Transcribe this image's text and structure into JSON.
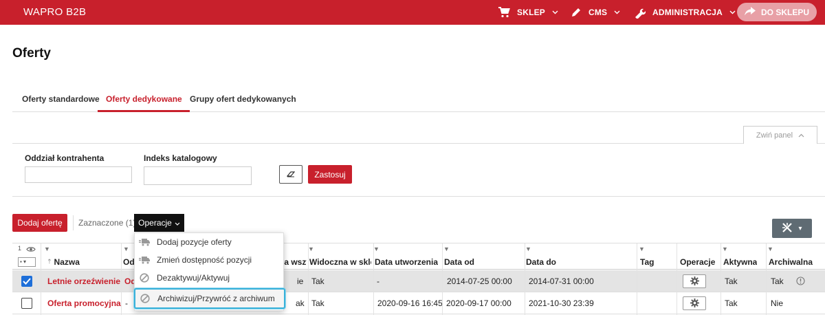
{
  "topbar": {
    "brand": "WAPRO B2B",
    "nav": [
      {
        "label": "SKLEP",
        "icon": "cart-icon"
      },
      {
        "label": "CMS",
        "icon": "pencil-icon"
      },
      {
        "label": "ADMINISTRACJA",
        "icon": "wrench-icon"
      }
    ],
    "shop_button": "DO SKLEPU",
    "brand_color": "#c8202c"
  },
  "page_title": "Oferty",
  "tabs": [
    {
      "label": "Oferty standardowe",
      "active": false
    },
    {
      "label": "Oferty dedykowane",
      "active": true
    },
    {
      "label": "Grupy ofert dedykowanych",
      "active": false
    }
  ],
  "panel": {
    "collapse_label": "Zwiń panel"
  },
  "filters": {
    "fields": [
      {
        "label": "Oddział kontrahenta",
        "value": ""
      },
      {
        "label": "Indeks katalogowy",
        "value": ""
      }
    ],
    "apply_label": "Zastosuj"
  },
  "toolbar": {
    "add_label": "Dodaj ofertę",
    "selected_label": "Zaznaczone (1)",
    "operations_label": "Operacje"
  },
  "dropdown": {
    "items": [
      {
        "label": "Dodaj pozycje oferty",
        "icon": "truck-add-icon"
      },
      {
        "label": "Zmień dostępność pozycji",
        "icon": "truck-edit-icon"
      },
      {
        "label": "Dezaktywuj/Aktywuj",
        "icon": "block-icon"
      },
      {
        "label": "Archiwizuj/Przywróć z archiwum",
        "icon": "block-icon",
        "highlighted": true
      }
    ]
  },
  "grid": {
    "pin_count": "1",
    "columns": [
      "Nazwa",
      "Od",
      "la wszy",
      "Widoczna w sklepi",
      "Data utworzenia",
      "Data od",
      "Data do",
      "Tag",
      "Operacje",
      "Aktywna",
      "Archiwalna"
    ],
    "rows": [
      {
        "selected": true,
        "name": "Letnie orzeźwienie",
        "od": "Od",
        "wszy": "ie",
        "visible": "Tak",
        "created": "-",
        "from": "2014-07-25 00:00",
        "to": "2014-07-31 00:00",
        "tag": "",
        "active": "Tak",
        "archived": "Tak"
      },
      {
        "selected": false,
        "name": "Oferta promocyjna",
        "od": "-",
        "wszy": "ak",
        "visible": "Tak",
        "created": "2020-09-16 16:45",
        "from": "2020-09-17 00:00",
        "to": "2021-10-30 23:39",
        "tag": "",
        "active": "Tak",
        "archived": "Nie"
      }
    ]
  }
}
